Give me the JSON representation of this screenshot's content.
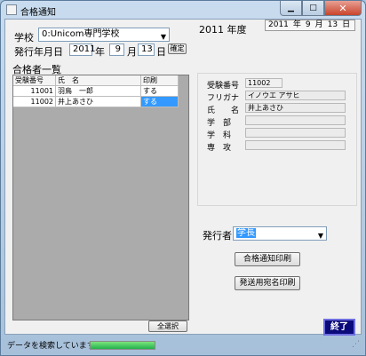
{
  "window": {
    "title": "合格通知"
  },
  "header": {
    "school_label": "学校",
    "school_value": "0:Unicom専門学校",
    "issue_date_label": "発行年月日",
    "issue_year": "2011",
    "year_unit": "年",
    "issue_month": "9",
    "month_unit": "月",
    "issue_day": "13",
    "day_unit": "日",
    "confirm_button": "確定",
    "fiscal_year_text": "2011 年度",
    "top_date_year": "2011",
    "top_date_month": "9",
    "top_date_day": "13"
  },
  "list": {
    "title": "合格者一覧",
    "columns": [
      "受験番号",
      "氏　名",
      "印刷"
    ],
    "rows": [
      {
        "id": "11001",
        "name": "羽鳥　一郎",
        "print": "する"
      },
      {
        "id": "11002",
        "name": "井上あさひ",
        "print": "する"
      }
    ],
    "select_all_button": "全選択"
  },
  "detail": {
    "exam_no_label": "受験番号",
    "exam_no_value": "11002",
    "furigana_label": "フリガナ",
    "furigana_value": "イノウエ アサヒ",
    "name_label": "氏　　名",
    "name_value": "井上あさひ",
    "faculty_label": "学　部",
    "faculty_value": "",
    "department_label": "学　科",
    "department_value": "",
    "major_label": "専　攻",
    "major_value": ""
  },
  "issuer": {
    "label": "発行者",
    "value": "学長"
  },
  "buttons": {
    "print_notice": "合格通知印刷",
    "print_address": "発送用宛名印刷",
    "exit": "終了"
  },
  "status": {
    "text": "データを検索しています。",
    "progress_fraction": 1.0
  }
}
